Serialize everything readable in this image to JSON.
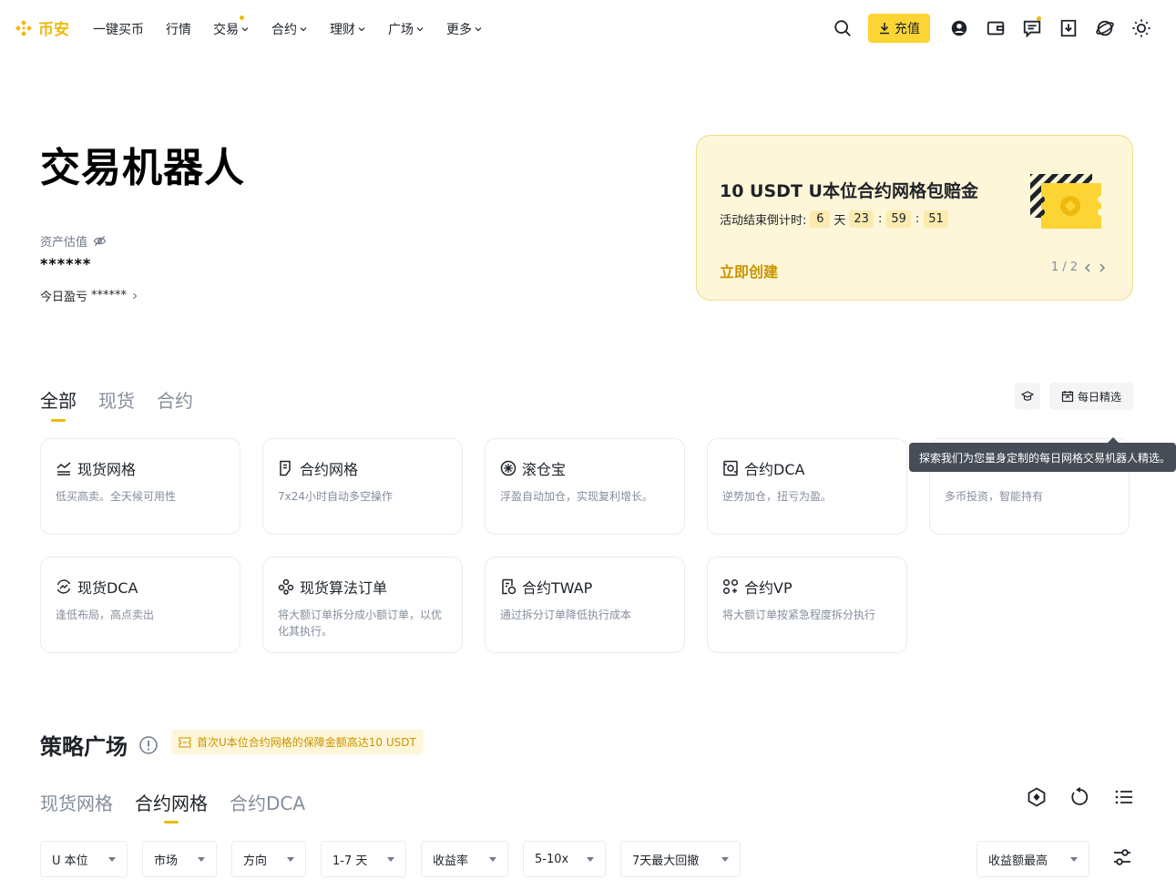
{
  "header": {
    "logo_text": "币安",
    "nav": [
      {
        "label": "一键买币",
        "has_chevron": false,
        "dot": false
      },
      {
        "label": "行情",
        "has_chevron": false,
        "dot": false
      },
      {
        "label": "交易",
        "has_chevron": true,
        "dot": true
      },
      {
        "label": "合约",
        "has_chevron": true,
        "dot": false
      },
      {
        "label": "理财",
        "has_chevron": true,
        "dot": false
      },
      {
        "label": "广场",
        "has_chevron": true,
        "dot": false
      },
      {
        "label": "更多",
        "has_chevron": true,
        "dot": false
      }
    ],
    "deposit_label": "充值"
  },
  "page": {
    "title": "交易机器人",
    "asset_label": "资产估值",
    "asset_value": "******",
    "pnl_label": "今日盈亏",
    "pnl_value": "******"
  },
  "promo": {
    "title": "10 USDT U本位合约网格包赔金",
    "countdown_label": "活动结束倒计时:",
    "days": "6",
    "days_unit": "天",
    "hours": "23",
    "minutes": "59",
    "seconds": "51",
    "sep": ":",
    "cta": "立即创建",
    "pager": "1 / 2"
  },
  "tabs": [
    "全部",
    "现货",
    "合约"
  ],
  "tools": {
    "daily_pick": "每日精选",
    "tooltip": "探索我们为您量身定制的每日网格交易机器人精选。"
  },
  "cards": [
    {
      "title": "现货网格",
      "desc": "低买高卖。全天候可用性",
      "icon": "grid-chart-icon"
    },
    {
      "title": "合约网格",
      "desc": "7x24小时自动多空操作",
      "icon": "document-icon"
    },
    {
      "title": "滚仓宝",
      "desc": "浮盈自动加仓，实现复利增长。",
      "icon": "rolling-icon"
    },
    {
      "title": "合约DCA",
      "desc": "逆势加仓，扭亏为盈。",
      "icon": "dca-icon"
    },
    {
      "title": "",
      "desc": "多币投资，智能持有",
      "icon": ""
    },
    {
      "title": "现货DCA",
      "desc": "逢低布局，高点卖出",
      "icon": "cycle-chart-icon"
    },
    {
      "title": "现货算法订单",
      "desc": "将大额订单拆分成小额订单，以优化其执行。",
      "icon": "algo-icon"
    },
    {
      "title": "合约TWAP",
      "desc": "通过拆分订单降低执行成本",
      "icon": "twap-icon"
    },
    {
      "title": "合约VP",
      "desc": "将大额订单按紧急程度拆分执行",
      "icon": "vp-icon"
    }
  ],
  "plaza": {
    "title": "策略广场",
    "badge": "首次U本位合约网格的保障金额高达10 USDT",
    "sub_tabs": [
      "现货网格",
      "合约网格",
      "合约DCA"
    ],
    "filters": [
      "U 本位",
      "市场",
      "方向",
      "1-7 天",
      "收益率",
      "5-10x",
      "7天最大回撤"
    ],
    "sort": "收益额最高"
  },
  "colors": {
    "brand": "#f0b90b",
    "button": "#fcd535",
    "promo_bg": "#fef6d8",
    "cta": "#c99400"
  }
}
